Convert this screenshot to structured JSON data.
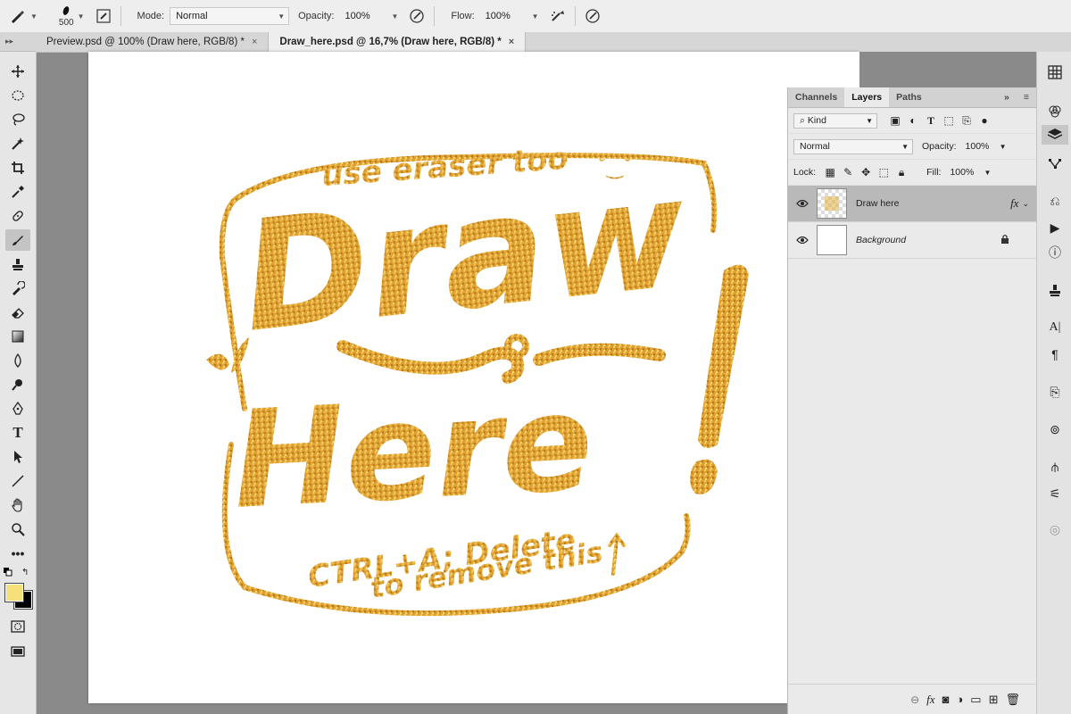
{
  "options_bar": {
    "brush_size": "500",
    "mode_label": "Mode:",
    "mode_value": "Normal",
    "opacity_label": "Opacity:",
    "opacity_value": "100%",
    "flow_label": "Flow:",
    "flow_value": "100%"
  },
  "tabs": [
    {
      "label": "Preview.psd @ 100% (Draw here, RGB/8) *",
      "close": "×",
      "active": false
    },
    {
      "label": "Draw_here.psd @ 16,7% (Draw here, RGB/8) *",
      "close": "×",
      "active": true
    }
  ],
  "canvas_art": {
    "line1": "use eraser too",
    "line2": "Draw",
    "line3": "Here",
    "line4": "CTRL+A; Delete",
    "line5": "to remove this",
    "color": "#d99a26"
  },
  "layers_panel": {
    "tabs": [
      "Channels",
      "Layers",
      "Paths"
    ],
    "active_tab": "Layers",
    "more": "»",
    "filter_label": "Kind",
    "blend_mode": "Normal",
    "opacity_label": "Opacity:",
    "opacity_value": "100%",
    "lock_label": "Lock:",
    "fill_label": "Fill:",
    "fill_value": "100%",
    "layers": [
      {
        "name": "Draw here",
        "fx": "fx",
        "selected": true
      },
      {
        "name": "Background",
        "locked": true
      }
    ]
  },
  "colors": {
    "foreground": "#f5e07a",
    "background": "#000000",
    "accent_gold": "#d99a26"
  }
}
